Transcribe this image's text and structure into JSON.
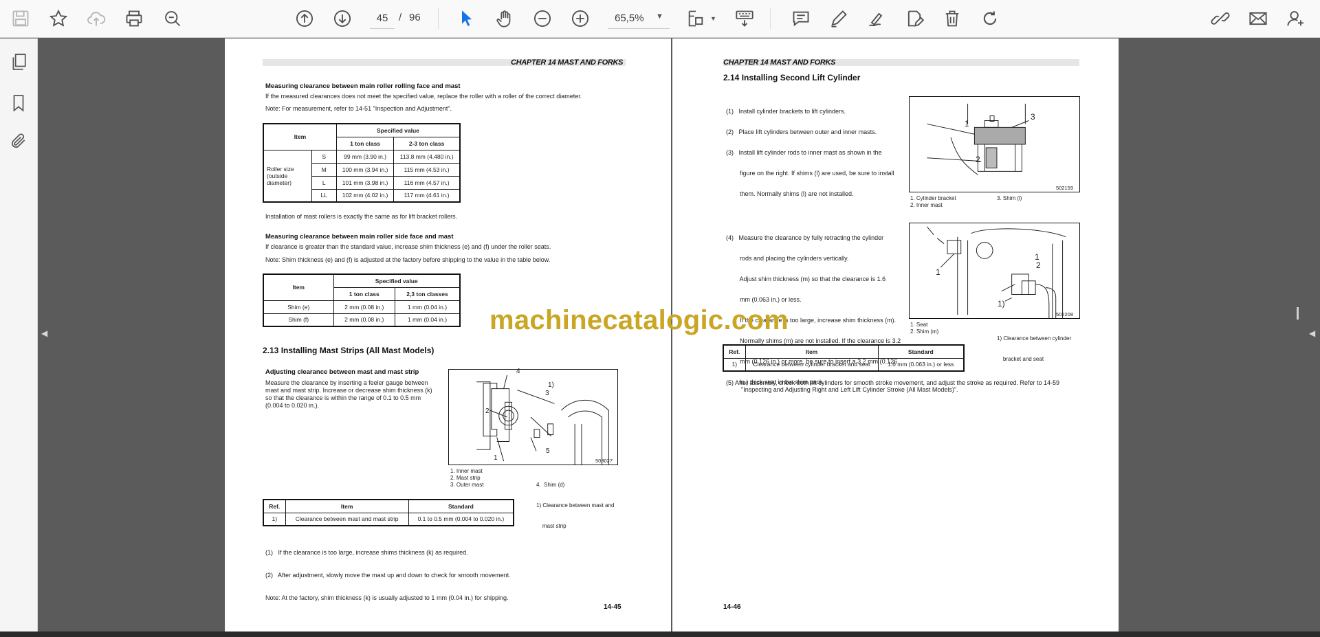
{
  "toolbar": {
    "page_current": "45",
    "page_separator": "/",
    "page_total": "96",
    "zoom": "65,5%"
  },
  "doc": {
    "left": {
      "chapter": "CHAPTER 14 MAST AND FORKS",
      "s1_title": "Measuring clearance between main roller rolling face and mast",
      "s1_p1": "If the measured clearances does not meet the specified value, replace the roller with a roller of the correct diameter.",
      "s1_note": "Note: For measurement, refer to 14-51 \"Inspection and Adjustment\".",
      "t1": {
        "item": "Item",
        "specified": "Specified value",
        "col1": "1 ton class",
        "col2": "2-3 ton class",
        "row_label": "Roller size (outside diameter)",
        "rows": [
          {
            "size": "S",
            "a": "99 mm (3.90 in.)",
            "b": "113.8 mm (4.480 in.)"
          },
          {
            "size": "M",
            "a": "100 mm (3.94 in.)",
            "b": "115 mm (4.53 in.)"
          },
          {
            "size": "L",
            "a": "101 mm (3.98 in.)",
            "b": "116 mm (4.57 in.)"
          },
          {
            "size": "LL",
            "a": "102 mm (4.02 in.)",
            "b": "117 mm (4.61 in.)"
          }
        ]
      },
      "s1_after": "Installation of mast rollers is exactly the same as for lift bracket rollers.",
      "s2_title": "Measuring clearance between main roller side face and mast",
      "s2_p1": "If clearance is greater than the standard value, increase shim thickness (e) and (f) under the roller seats.",
      "s2_note": "Note: Shim thickness (e) and (f) is adjusted at the factory before shipping to the value in the table below.",
      "t2": {
        "item": "Item",
        "specified": "Specified value",
        "col1": "1 ton class",
        "col2": "2,3 ton classes",
        "rows": [
          {
            "item": "Shim (e)",
            "a": "2 mm (0.08 in.)",
            "b": "1 mm (0.04 in.)"
          },
          {
            "item": "Shim (f)",
            "a": "2 mm (0.08 in.)",
            "b": "1 mm (0.04 in.)"
          }
        ]
      },
      "s3_title": "2.13    Installing Mast Strips (All Mast Models)",
      "s3_sub": "Adjusting clearance between mast and mast strip",
      "s3_p1": "Measure the clearance by inserting a feeler gauge between mast and mast strip. Increase or decrease shim thickness (k) so that the clearance is within the range of 0.1 to 0.5 mm (0.004 to 0.020 in.).",
      "fig_code": "503027",
      "fig_labels": [
        "4",
        "1)",
        "3",
        "2",
        "5",
        "1"
      ],
      "caption_col1": [
        "1. Inner mast",
        "2. Mast strip",
        "3. Outer mast"
      ],
      "caption_col2": [
        "4.  Shim (d)",
        "1) Clearance between mast and",
        "    mast strip"
      ],
      "t3": {
        "ref": "Ref.",
        "item": "Item",
        "standard": "Standard",
        "row": {
          "ref": "1)",
          "item": "Clearance between mast and mast strip",
          "std": "0.1 to 0.5 mm (0.004 to 0.020 in.)"
        }
      },
      "steps": [
        "(1)   If the clearance is too large, increase shims thickness (k) as required.",
        "(2)   After adjustment, slowly move the mast up and down to check for smooth movement.",
        "Note: At the factory, shim thickness (k) is usually adjusted to 1 mm (0.04 in.) for shipping."
      ],
      "page_number": "14-45"
    },
    "right": {
      "chapter": "CHAPTER 14 MAST AND FORKS",
      "title": "2.14    Installing Second Lift Cylinder",
      "steps_a": [
        "(1)   Install cylinder brackets to lift cylinders.",
        "(2)   Place lift cylinders between outer and inner masts.",
        "(3)   Install lift cylinder rods to inner mast as shown in the",
        "        figure on the right. If shims (l) are used, be sure to install",
        "        them. Normally shims (l) are not installed."
      ],
      "fig1_code": "502159",
      "fig1_labels": [
        "1",
        "3",
        "2"
      ],
      "fig1_caption_col1": [
        "1. Cylinder bracket",
        "2. Inner mast"
      ],
      "fig1_caption_col2": [
        "3. Shim (l)"
      ],
      "steps_b": [
        "(4)   Measure the clearance by fully retracting the cylinder",
        "        rods and placing the cylinders vertically.",
        "        Adjust shim thickness (m) so that the clearance is 1.6",
        "        mm (0.063 in.) or less.",
        "        If the clearance is too large, increase shim thickness (m).",
        "        Normally shims (m) are not installed. If the clearance is 3.2",
        "        mm (0.126 in.) or more, be sure to insert a 3.2 mm (0.126",
        "        in.) thick seat in the shim pack."
      ],
      "fig2_code": "502208",
      "fig2_labels": [
        "1",
        "1",
        "2",
        "1)"
      ],
      "fig2_caption_col1": [
        "1. Seat",
        "2. Shim (m)"
      ],
      "fig2_caption_col2": [
        "1) Clearance between cylinder",
        "    bracket and seat"
      ],
      "t4": {
        "ref": "Ref.",
        "item": "Item",
        "standard": "Standard",
        "row": {
          "ref": "1)",
          "item": "Clearance between cylinder bracket and seat",
          "std": "1.6 mm (0.063 in.) or less"
        }
      },
      "step5_l1": "(5)   After assembly, check both lift cylinders for smooth stroke movement, and adjust the stroke as required. Refer to 14-59",
      "step5_l2": "\"Inspecting and Adjusting Right and Left Lift Cylinder Stroke (All Mast Models)\".",
      "page_number": "14-46"
    }
  },
  "watermark": "machinecatalogic.com",
  "colors": {
    "accent": "#1473e6",
    "watermark": "#c9a624",
    "viewer_bg": "#5b5b5b",
    "toolbar_bg": "#f9f9f9"
  },
  "icons": {
    "toolbar": [
      "save-icon",
      "star-icon",
      "cloud-upload-icon",
      "print-icon",
      "find-icon",
      "page-up-icon",
      "page-down-icon",
      "select-arrow-icon",
      "hand-icon",
      "zoom-out-icon",
      "zoom-in-icon",
      "fit-page-icon",
      "keyboard-icon",
      "comment-icon",
      "pen-icon",
      "sign-icon",
      "edit-pdf-icon",
      "delete-icon",
      "redo-icon",
      "share-link-icon",
      "mail-icon",
      "add-user-icon"
    ],
    "left_rail": [
      "pages-icon",
      "bookmark-icon",
      "attachment-icon"
    ]
  }
}
